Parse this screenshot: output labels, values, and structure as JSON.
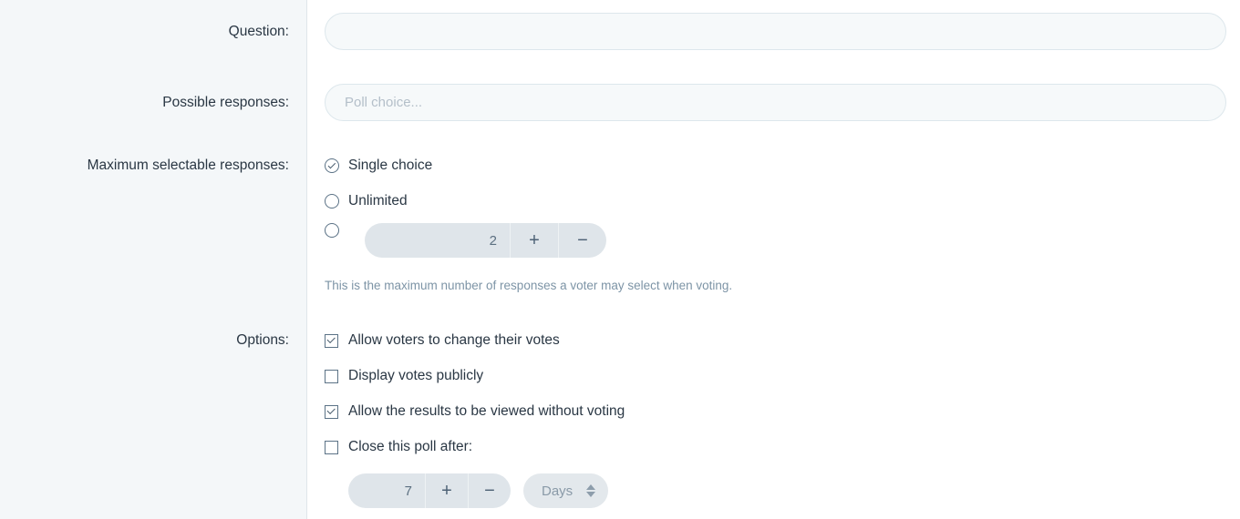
{
  "labels": {
    "question": "Question:",
    "possible_responses": "Possible responses:",
    "maximum_selectable": "Maximum selectable responses:",
    "options": "Options:"
  },
  "question_field": {
    "value": "",
    "placeholder": ""
  },
  "response_field": {
    "value": "",
    "placeholder": "Poll choice..."
  },
  "maximum_selectable": {
    "choices": [
      {
        "label": "Single choice",
        "selected": true
      },
      {
        "label": "Unlimited",
        "selected": false
      },
      {
        "label": "",
        "selected": false
      }
    ],
    "stepper": {
      "value": "2",
      "increment_label": "+",
      "decrement_label": "−"
    },
    "help_text": "This is the maximum number of responses a voter may select when voting."
  },
  "options": {
    "checkboxes": [
      {
        "label": "Allow voters to change their votes",
        "checked": true
      },
      {
        "label": "Display votes publicly",
        "checked": false
      },
      {
        "label": "Allow the results to be viewed without voting",
        "checked": true
      },
      {
        "label": "Close this poll after:",
        "checked": false
      }
    ],
    "duration": {
      "value": "7",
      "increment_label": "+",
      "decrement_label": "−",
      "unit": "Days"
    }
  },
  "colors": {
    "panel_background": "#f4f7f9",
    "content_background": "#ffffff",
    "divider": "#dfe6ea",
    "input_border": "#dde7ec",
    "input_fill": "#f6f9fa",
    "control_fill": "#dfe5ea",
    "text_primary": "#2a3744",
    "text_muted": "#7d94a6"
  }
}
